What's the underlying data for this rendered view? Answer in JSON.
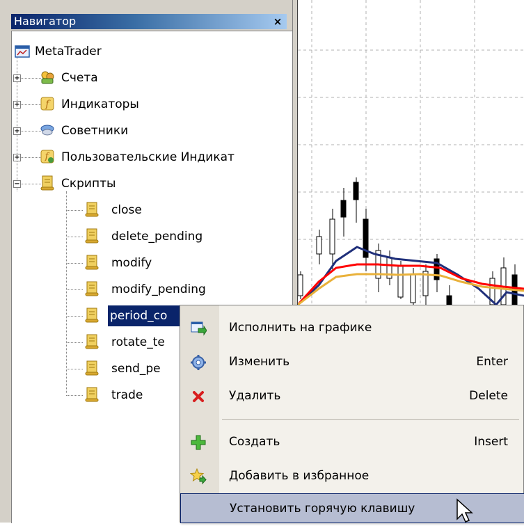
{
  "navigator": {
    "title": "Навигатор",
    "close": "×",
    "root": "MetaTrader",
    "folders": [
      {
        "label": "Счета",
        "icon": "accounts-icon",
        "state": "+"
      },
      {
        "label": "Индикаторы",
        "icon": "indicators-icon",
        "state": "+"
      },
      {
        "label": "Советники",
        "icon": "experts-icon",
        "state": "+"
      },
      {
        "label": "Пользовательские Индикат",
        "icon": "custom-indicators-icon",
        "state": "+"
      },
      {
        "label": "Скрипты",
        "icon": "scripts-icon",
        "state": "−"
      }
    ],
    "scripts": [
      "close",
      "delete_pending",
      "modify",
      "modify_pending",
      "period_co",
      "rotate_te",
      "send_pe",
      "trade"
    ],
    "selected_script": "period_co"
  },
  "context_menu": {
    "items": [
      {
        "label": "Исполнить на графике",
        "shortcut": "",
        "icon": "execute-on-chart-icon"
      },
      {
        "label": "Изменить",
        "shortcut": "Enter",
        "icon": "modify-icon"
      },
      {
        "label": "Удалить",
        "shortcut": "Delete",
        "icon": "delete-icon"
      },
      {
        "label": "Создать",
        "shortcut": "Insert",
        "icon": "create-icon"
      },
      {
        "label": "Добавить в избранное",
        "shortcut": "",
        "icon": "add-to-favorites-icon"
      },
      {
        "label": "Установить горячую клавишу",
        "shortcut": "",
        "icon": ""
      }
    ],
    "highlighted": "Установить горячую клавишу"
  },
  "colors": {
    "title_bar": "#0a246a",
    "selection": "#0a246a",
    "ma_blue": "#1f2f7a",
    "ma_red": "#ff0000",
    "ma_orange": "#e9b13a"
  }
}
